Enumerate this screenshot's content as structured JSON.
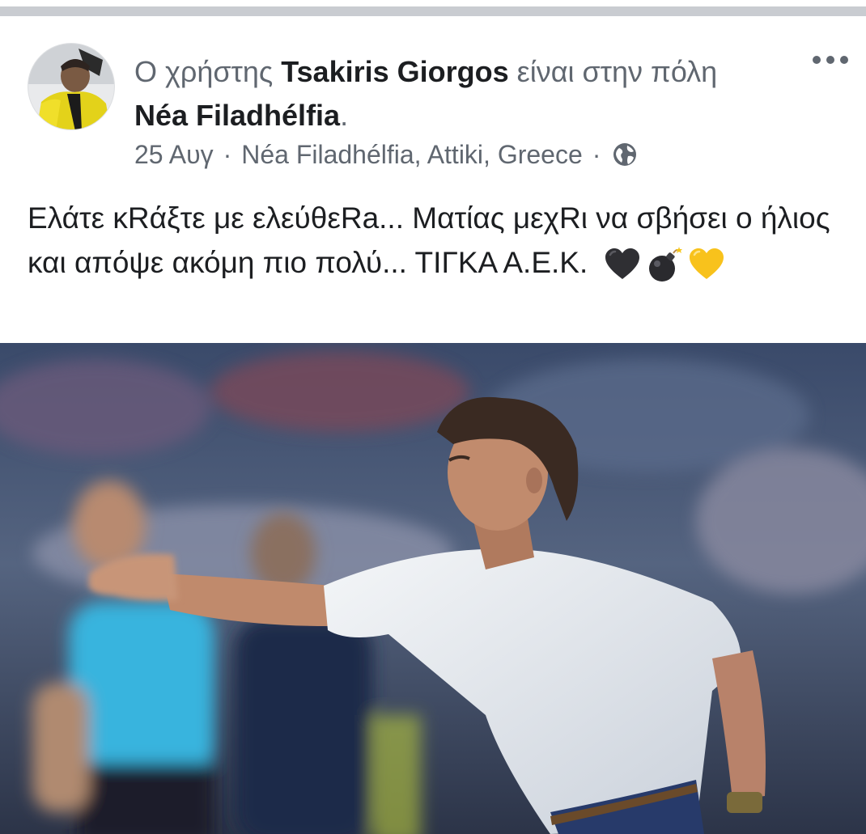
{
  "post": {
    "author_prefix": "Ο χρήστης ",
    "author_name": "Tsakiris Giorgos",
    "author_middle": " είναι στην πόλη ",
    "location_name": "Néa Filadhélfia",
    "author_suffix": ".",
    "date": "25 Αυγ",
    "location_detail": "Néa Filadhélfia, Attiki, Greece",
    "separator": "·",
    "privacy_icon": "globe-icon",
    "text": "Ελάτε κRάξτε με ελεύθεRa... Ματίας μεχRι να σβήσει ο ήλιος και απόψε ακόμη πιο πολύ... ΤΙΓΚΑ Α.Ε.Κ.",
    "emojis": [
      "black-heart",
      "bomb",
      "yellow-heart"
    ],
    "more_icon": "more-horizontal-icon"
  },
  "colors": {
    "divider": "#c9ccd1",
    "secondary_text": "#606770",
    "primary_text": "#1c1e21",
    "aek_yellow": "#f5d90a"
  }
}
